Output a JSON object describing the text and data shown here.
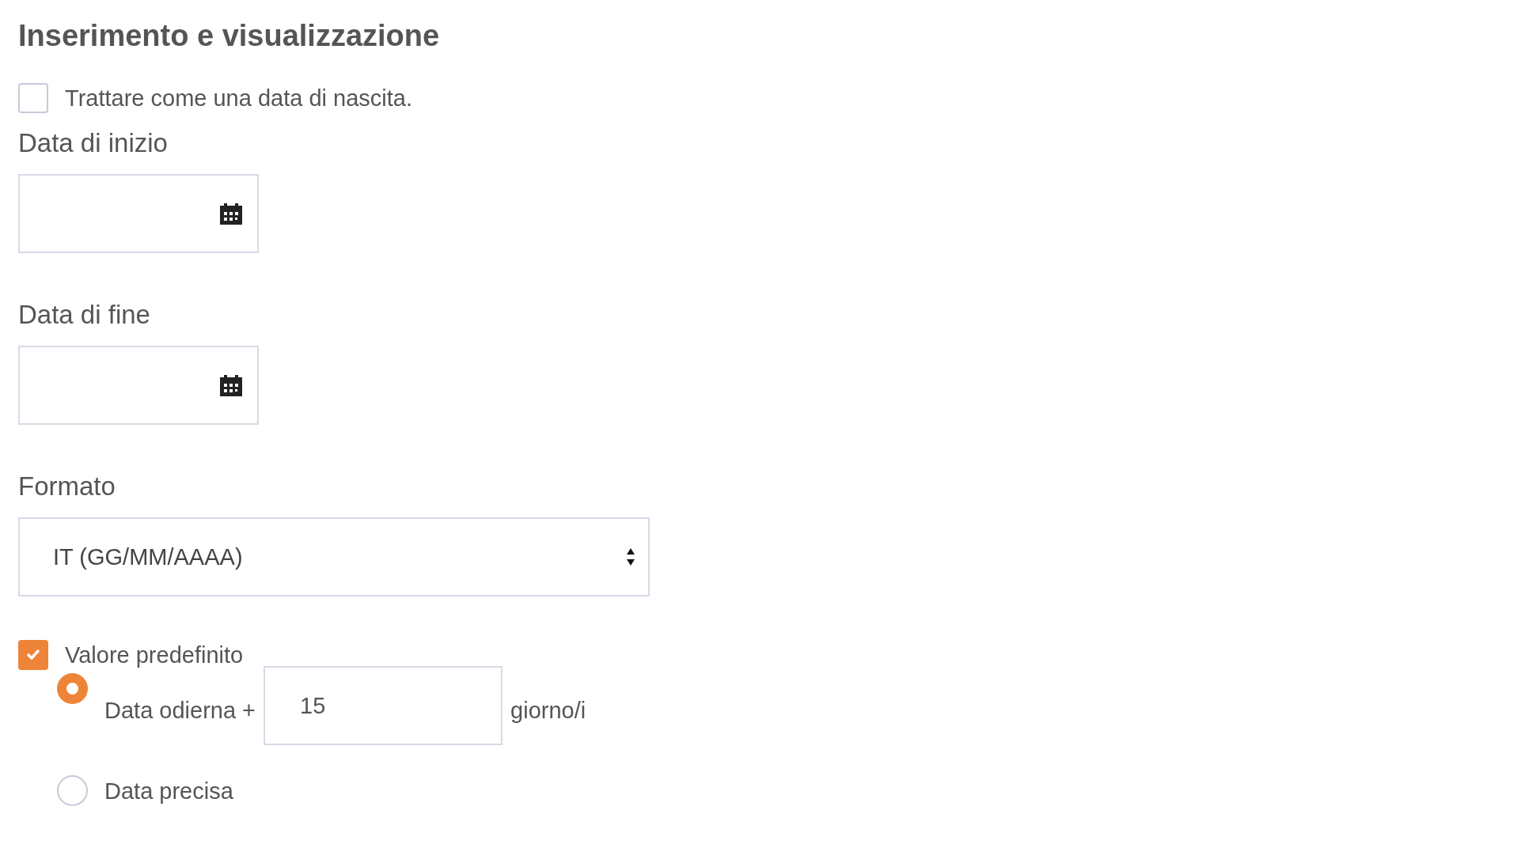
{
  "heading": "Inserimento e visualizzazione",
  "birth_checkbox": {
    "label": "Trattare come una data di nascita.",
    "checked": false
  },
  "date_fields": [
    {
      "label": "Data di inizio"
    },
    {
      "label": "Data di fine"
    }
  ],
  "format": {
    "label": "Formato",
    "value": "IT (GG/MM/AAAA)"
  },
  "default_value": {
    "label": "Valore predefinito",
    "checked": true,
    "options": [
      {
        "kind": "offset",
        "label": "Data odierna +",
        "value": "15",
        "unit": "giorno/i",
        "selected": true
      },
      {
        "kind": "exact",
        "label": "Data precisa",
        "selected": false
      }
    ]
  }
}
